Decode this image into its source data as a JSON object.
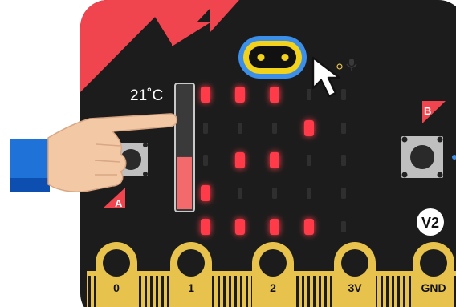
{
  "simulator": {
    "temperature_label": "21˚C",
    "temperature_level": 0.42,
    "version_badge": "V2",
    "button_a_label": "A",
    "button_b_label": "B"
  },
  "pins": [
    "0",
    "1",
    "2",
    "3V",
    "GND"
  ],
  "led_matrix": [
    [
      1,
      1,
      1,
      0,
      0
    ],
    [
      0,
      0,
      0,
      1,
      0
    ],
    [
      0,
      1,
      1,
      0,
      0
    ],
    [
      1,
      0,
      0,
      0,
      0
    ],
    [
      1,
      1,
      1,
      1,
      0
    ]
  ],
  "colors": {
    "board": "#1c1c1c",
    "accent_red": "#f0444e",
    "pin_gold": "#e7c24c",
    "led_on": "#ff3b4a",
    "logo_ring_outer": "#3b8fe8",
    "logo_ring_inner": "#f2d21a",
    "sleeve_blue": "#1f72d8",
    "skin": "#f3c9a5"
  },
  "icons": {
    "cursor": "pointer-arrow-icon",
    "logo": "microbit-logo-icon",
    "mic": "microphone-icon",
    "hand": "pointing-hand-icon"
  }
}
